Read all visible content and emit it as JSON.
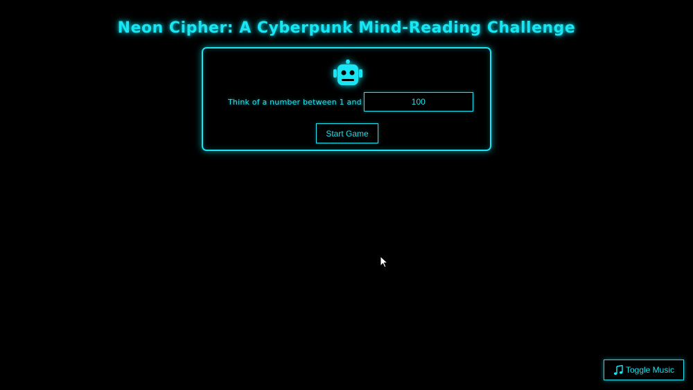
{
  "header": {
    "title": "Neon Cipher: A Cyberpunk Mind-Reading Challenge"
  },
  "game": {
    "icon": "robot-icon",
    "prompt": "Think of a number between 1 and",
    "max_number": "100",
    "start_label": "Start Game"
  },
  "music": {
    "icon": "music-note-icon",
    "label": "Toggle Music"
  },
  "colors": {
    "background": "#000000",
    "accent": "#19e6f2"
  }
}
